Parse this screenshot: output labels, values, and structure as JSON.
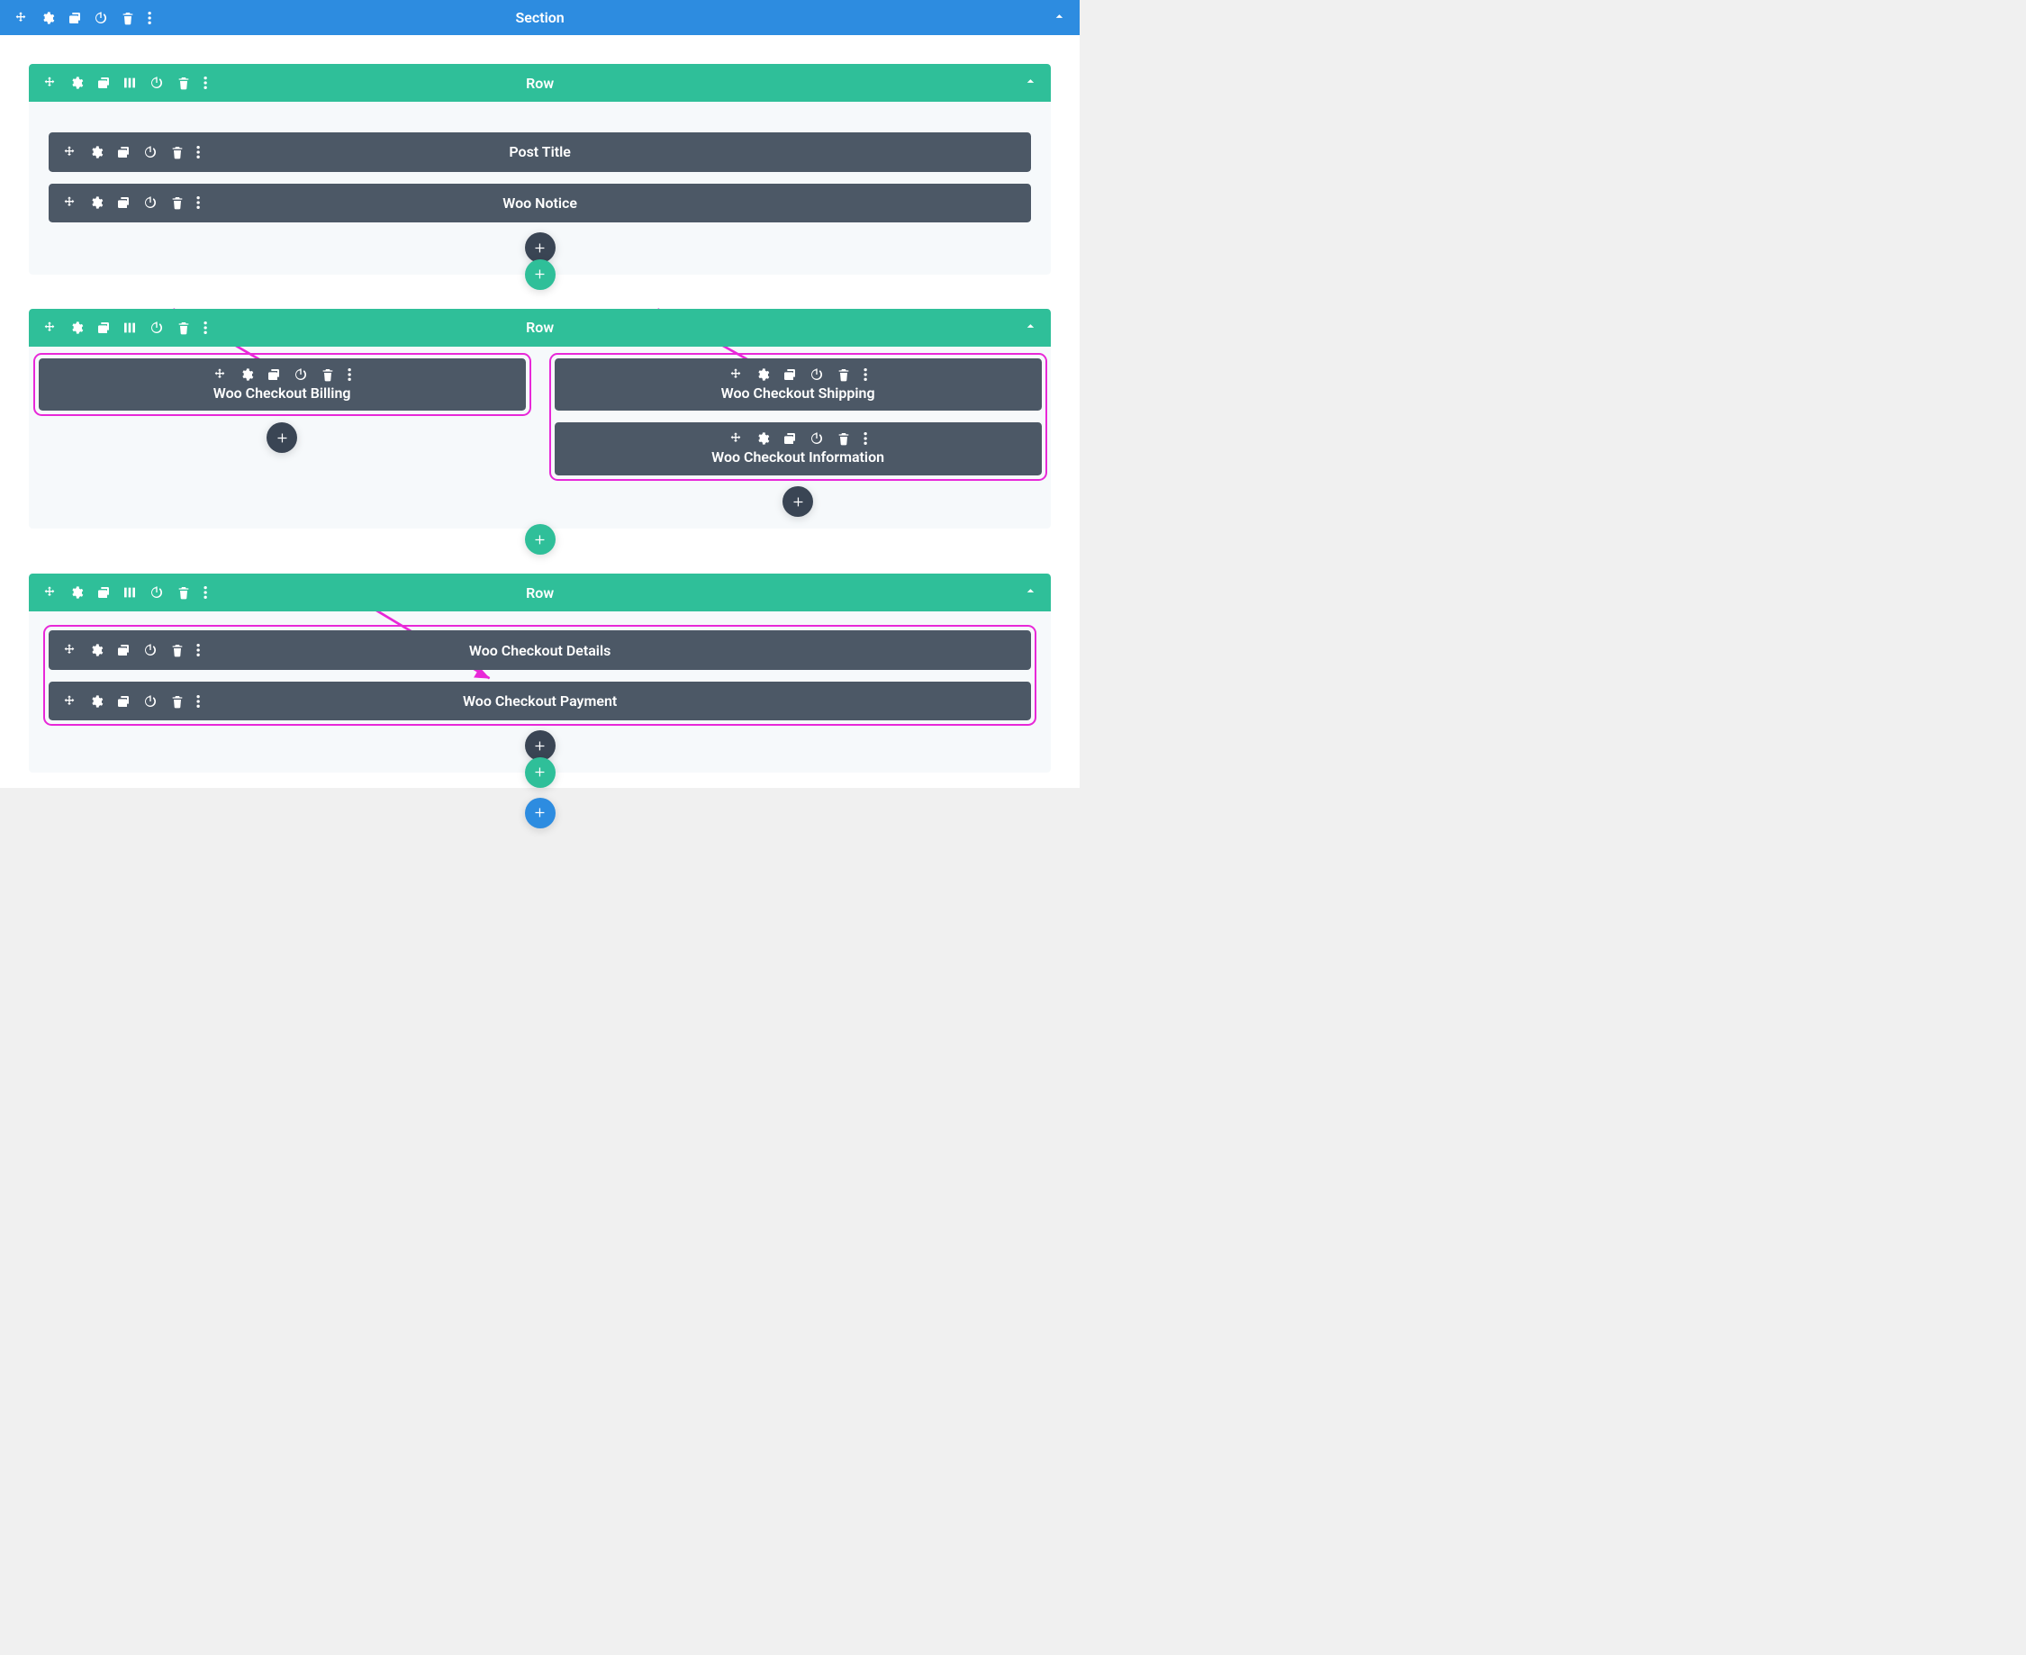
{
  "section": {
    "label": "Section"
  },
  "rows": [
    {
      "label": "Row",
      "modules": [
        "Post Title",
        "Woo Notice"
      ]
    },
    {
      "label": "Row",
      "col1": [
        "Woo Checkout Billing"
      ],
      "col2": [
        "Woo Checkout Shipping",
        "Woo Checkout Information"
      ]
    },
    {
      "label": "Row",
      "modules": [
        "Woo Checkout Details",
        "Woo Checkout Payment"
      ]
    }
  ],
  "colors": {
    "section": "#2d8ce0",
    "row": "#2fbf99",
    "module": "#4c5866",
    "highlight": "#e828d8"
  }
}
